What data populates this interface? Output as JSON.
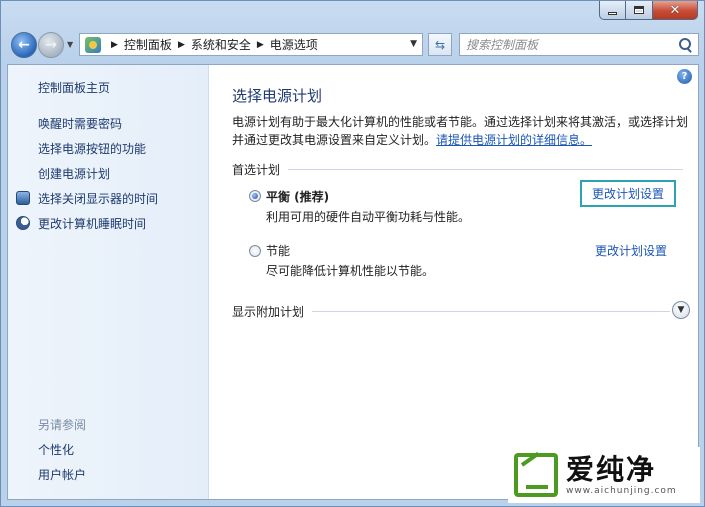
{
  "window": {
    "controls": {
      "minimize": "minimize",
      "maximize": "maximize",
      "close": "✕"
    }
  },
  "address": {
    "breadcrumbs": [
      "控制面板",
      "系统和安全",
      "电源选项"
    ]
  },
  "search": {
    "placeholder": "搜索控制面板"
  },
  "sidebar": {
    "items": [
      {
        "label": "控制面板主页"
      },
      {
        "label": "唤醒时需要密码"
      },
      {
        "label": "选择电源按钮的功能"
      },
      {
        "label": "创建电源计划"
      },
      {
        "label": "选择关闭显示器的时间",
        "icon": "monitor-icon"
      },
      {
        "label": "更改计算机睡眠时间",
        "icon": "moon-icon"
      }
    ],
    "see_also": {
      "heading": "另请参阅",
      "items": [
        {
          "label": "个性化"
        },
        {
          "label": "用户帐户"
        }
      ]
    }
  },
  "main": {
    "title": "选择电源计划",
    "intro_line1": "电源计划有助于最大化计算机的性能或者节能。通过选择计划来将其激活，或选择计划",
    "intro_line2": "并通过更改其电源设置来自定义计划。",
    "intro_link": "请提供电源计划的详细信息。",
    "preferred_heading": "首选计划",
    "plans": [
      {
        "name": "平衡 (推荐)",
        "desc": "利用可用的硬件自动平衡功耗与性能。",
        "change_link": "更改计划设置",
        "selected": true
      },
      {
        "name": "节能",
        "desc": "尽可能降低计算机性能以节能。",
        "change_link": "更改计划设置",
        "selected": false
      }
    ],
    "additional_heading": "显示附加计划",
    "help": "?"
  },
  "watermark": {
    "text": "爱纯净",
    "url": "www.aichunjing.com"
  }
}
